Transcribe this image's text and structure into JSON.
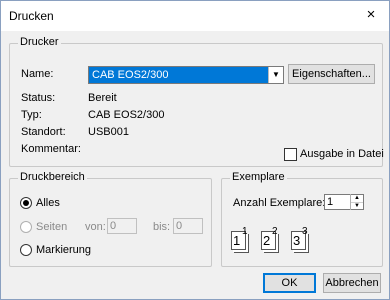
{
  "window": {
    "title": "Drucken",
    "close": "×"
  },
  "drucker": {
    "legend": "Drucker",
    "name_label": "Name:",
    "name_value": "CAB EOS2/300",
    "properties_button": "Eigenschaften...",
    "status_label": "Status:",
    "status_value": "Bereit",
    "type_label": "Typ:",
    "type_value": "CAB EOS2/300",
    "location_label": "Standort:",
    "location_value": "USB001",
    "comment_label": "Kommentar:",
    "print_to_file": "Ausgabe in Datei"
  },
  "druckbereich": {
    "legend": "Druckbereich",
    "all": "Alles",
    "pages": "Seiten",
    "from_label": "von:",
    "from_value": "0",
    "to_label": "bis:",
    "to_value": "0",
    "selection": "Markierung"
  },
  "exemplare": {
    "legend": "Exemplare",
    "count_label": "Anzahl Exemplare:",
    "count_value": "1",
    "collate_icons": [
      "1",
      "1",
      "2",
      "2",
      "3",
      "3"
    ]
  },
  "buttons": {
    "ok": "OK",
    "cancel": "Abbrechen"
  }
}
